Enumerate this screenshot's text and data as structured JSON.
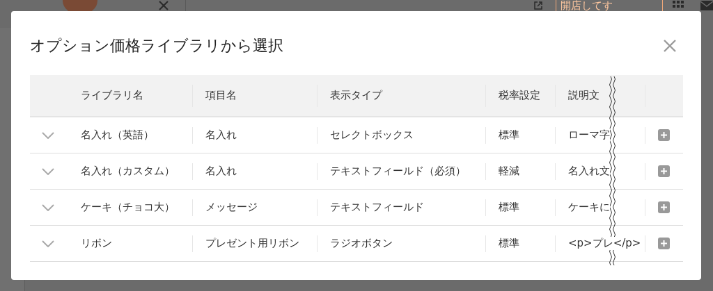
{
  "background": {
    "store_button": "開店してす"
  },
  "dialog": {
    "title": "オプション価格ライブラリから選択",
    "table": {
      "columns": [
        "ライブラリ名",
        "項目名",
        "表示タイプ",
        "税率設定",
        "説明文"
      ],
      "rows": [
        {
          "expanded": false,
          "cells": [
            "名入れ（英語）",
            "名入れ",
            "セレクトボックス",
            "標準",
            "ローマ字"
          ]
        },
        {
          "expanded": false,
          "cells": [
            "名入れ（カスタム）",
            "名入れ",
            "テキストフィールド（必須）",
            "軽減",
            "名入れ文"
          ]
        },
        {
          "expanded": false,
          "cells": [
            "ケーキ（チョコ大）",
            "メッセージ",
            "テキストフィールド",
            "標準",
            "ケーキに"
          ]
        },
        {
          "expanded": false,
          "cells": [
            "リボン",
            "プレゼント用リボン",
            "ラジオボタン",
            "標準",
            "<p>プレ</p>"
          ]
        }
      ]
    }
  }
}
